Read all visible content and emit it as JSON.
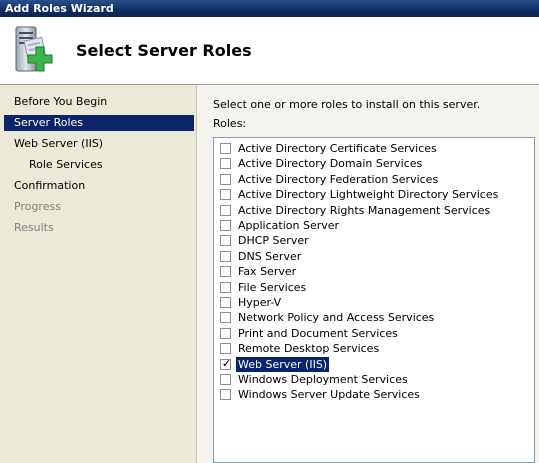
{
  "window": {
    "title": "Add Roles Wizard"
  },
  "header": {
    "title": "Select Server Roles",
    "icon": "server-add-icon"
  },
  "sidebar": {
    "items": [
      {
        "label": "Before You Begin",
        "state": "normal",
        "indent": 0
      },
      {
        "label": "Server Roles",
        "state": "active",
        "indent": 0
      },
      {
        "label": "Web Server (IIS)",
        "state": "normal",
        "indent": 0
      },
      {
        "label": "Role Services",
        "state": "normal",
        "indent": 1
      },
      {
        "label": "Confirmation",
        "state": "normal",
        "indent": 0
      },
      {
        "label": "Progress",
        "state": "disabled",
        "indent": 0
      },
      {
        "label": "Results",
        "state": "disabled",
        "indent": 0
      }
    ]
  },
  "main": {
    "instruction": "Select one or more roles to install on this server.",
    "roles_label": "Roles:",
    "roles": [
      {
        "label": "Active Directory Certificate Services",
        "checked": false,
        "selected": false
      },
      {
        "label": "Active Directory Domain Services",
        "checked": false,
        "selected": false
      },
      {
        "label": "Active Directory Federation Services",
        "checked": false,
        "selected": false
      },
      {
        "label": "Active Directory Lightweight Directory Services",
        "checked": false,
        "selected": false
      },
      {
        "label": "Active Directory Rights Management Services",
        "checked": false,
        "selected": false
      },
      {
        "label": "Application Server",
        "checked": false,
        "selected": false
      },
      {
        "label": "DHCP Server",
        "checked": false,
        "selected": false
      },
      {
        "label": "DNS Server",
        "checked": false,
        "selected": false
      },
      {
        "label": "Fax Server",
        "checked": false,
        "selected": false
      },
      {
        "label": "File Services",
        "checked": false,
        "selected": false
      },
      {
        "label": "Hyper-V",
        "checked": false,
        "selected": false
      },
      {
        "label": "Network Policy and Access Services",
        "checked": false,
        "selected": false
      },
      {
        "label": "Print and Document Services",
        "checked": false,
        "selected": false
      },
      {
        "label": "Remote Desktop Services",
        "checked": false,
        "selected": false
      },
      {
        "label": "Web Server (IIS)",
        "checked": true,
        "selected": true
      },
      {
        "label": "Windows Deployment Services",
        "checked": false,
        "selected": false
      },
      {
        "label": "Windows Server Update Services",
        "checked": false,
        "selected": false
      }
    ]
  },
  "colors": {
    "titlebar": "#0f2d63",
    "selection": "#0a246a",
    "sidebar_bg": "#ece9d8",
    "disabled_text": "#808080",
    "plus_green": "#3cb44b"
  }
}
